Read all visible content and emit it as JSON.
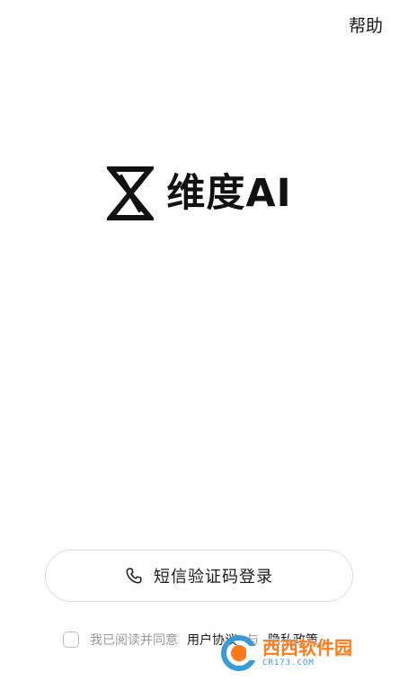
{
  "header": {
    "help_label": "帮助"
  },
  "brand": {
    "logo_icon": "hourglass-logo",
    "name": "维度AI"
  },
  "login": {
    "icon": "phone-icon",
    "label": "短信验证码登录"
  },
  "agreement": {
    "prefix": "我已阅读并同意",
    "user_agreement": "用户协议",
    "conjunction": "与",
    "privacy_policy": "隐私政策",
    "checked": false
  },
  "watermark": {
    "text": "西西软件园",
    "subtext": "CR173.COM"
  }
}
